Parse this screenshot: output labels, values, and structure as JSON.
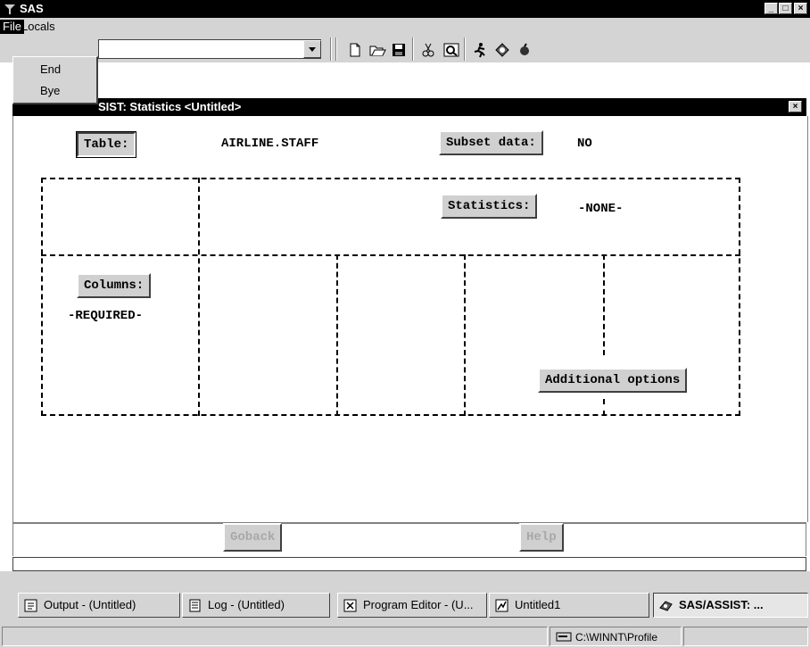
{
  "window": {
    "title": "SAS"
  },
  "menubar": {
    "file": "File",
    "locals": "Locals"
  },
  "file_menu": {
    "items": [
      "End",
      "Bye"
    ]
  },
  "toolbar": {
    "command_value": "",
    "icons": [
      "new-document-icon",
      "open-folder-icon",
      "save-icon",
      "cut-icon",
      "find-icon",
      "run-icon",
      "library-icon",
      "fruit-icon"
    ]
  },
  "inner_window": {
    "title": "SIST: Statistics <Untitled>"
  },
  "form": {
    "table_label": "Table:",
    "table_value": "AIRLINE.STAFF",
    "subset_label": "Subset data:",
    "subset_value": "NO",
    "statistics_label": "Statistics:",
    "statistics_value": "-NONE-",
    "columns_label": "Columns:",
    "columns_value": "-REQUIRED-",
    "additional_options_label": "Additional options"
  },
  "buttons": {
    "goback": "Goback",
    "help": "Help"
  },
  "taskbar": {
    "items": [
      {
        "label": "Output - (Untitled)",
        "icon": "output-icon"
      },
      {
        "label": "Log - (Untitled)",
        "icon": "log-icon"
      },
      {
        "label": "Program Editor - (U...",
        "icon": "program-editor-icon"
      },
      {
        "label": "Untitled1",
        "icon": "graph-icon"
      },
      {
        "label": "SAS/ASSIST: ...",
        "icon": "assist-icon"
      }
    ]
  },
  "status": {
    "path": "C:\\WINNT\\Profile"
  }
}
